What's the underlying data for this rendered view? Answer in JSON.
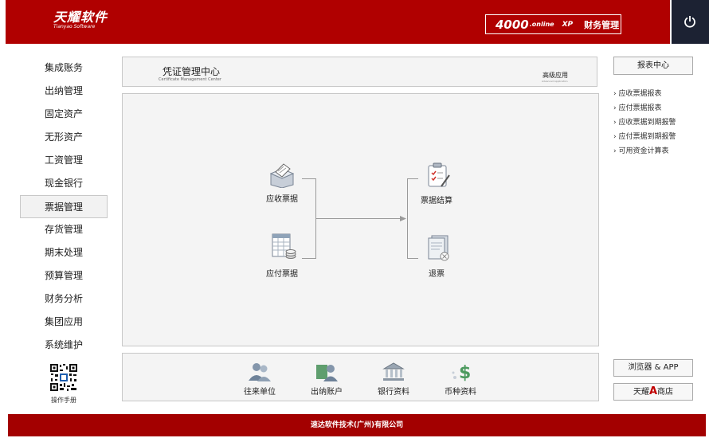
{
  "header": {
    "logo": "天耀软件",
    "logo_sub": "Tianyao Software",
    "product_num": "4000",
    "product_online": ".online",
    "product_xp": "XP",
    "product_name": "财务管理"
  },
  "sidebar": {
    "items": [
      {
        "label": "集成账务"
      },
      {
        "label": "出纳管理"
      },
      {
        "label": "固定资产"
      },
      {
        "label": "无形资产"
      },
      {
        "label": "工资管理"
      },
      {
        "label": "现金银行"
      },
      {
        "label": "票据管理"
      },
      {
        "label": "存货管理"
      },
      {
        "label": "期末处理"
      },
      {
        "label": "预算管理"
      },
      {
        "label": "财务分析"
      },
      {
        "label": "集团应用"
      },
      {
        "label": "系统维护"
      }
    ],
    "active_index": 6,
    "manual_label": "操作手册"
  },
  "title_panel": {
    "title": "凭证管理中心",
    "subtitle": "Certificate Management Center",
    "advanced": "高级应用",
    "advanced_sub": "Advanced Application"
  },
  "flow": {
    "receivable": "应收票据",
    "payable": "应付票据",
    "settlement": "票据结算",
    "refund": "退票"
  },
  "bottom": {
    "items": [
      {
        "label": "往来单位",
        "icon": "people-icon"
      },
      {
        "label": "出纳账户",
        "icon": "account-icon"
      },
      {
        "label": "银行资料",
        "icon": "bank-icon"
      },
      {
        "label": "币种资料",
        "icon": "currency-icon"
      }
    ]
  },
  "right": {
    "report_center": "报表中心",
    "links": [
      {
        "label": "应收票据报表"
      },
      {
        "label": "应付票据报表"
      },
      {
        "label": "应收票据到期报警"
      },
      {
        "label": "应付票据到期报警"
      },
      {
        "label": "可用资金计算表"
      }
    ],
    "browser_app": "浏览器 & APP",
    "shop_prefix": "天耀",
    "shop_a": "A",
    "shop_suffix": "商店"
  },
  "footer": {
    "text": "速达软件技术(广州)有限公司"
  },
  "colors": {
    "brand_red": "#b00000",
    "power_bg": "#1c2233"
  }
}
